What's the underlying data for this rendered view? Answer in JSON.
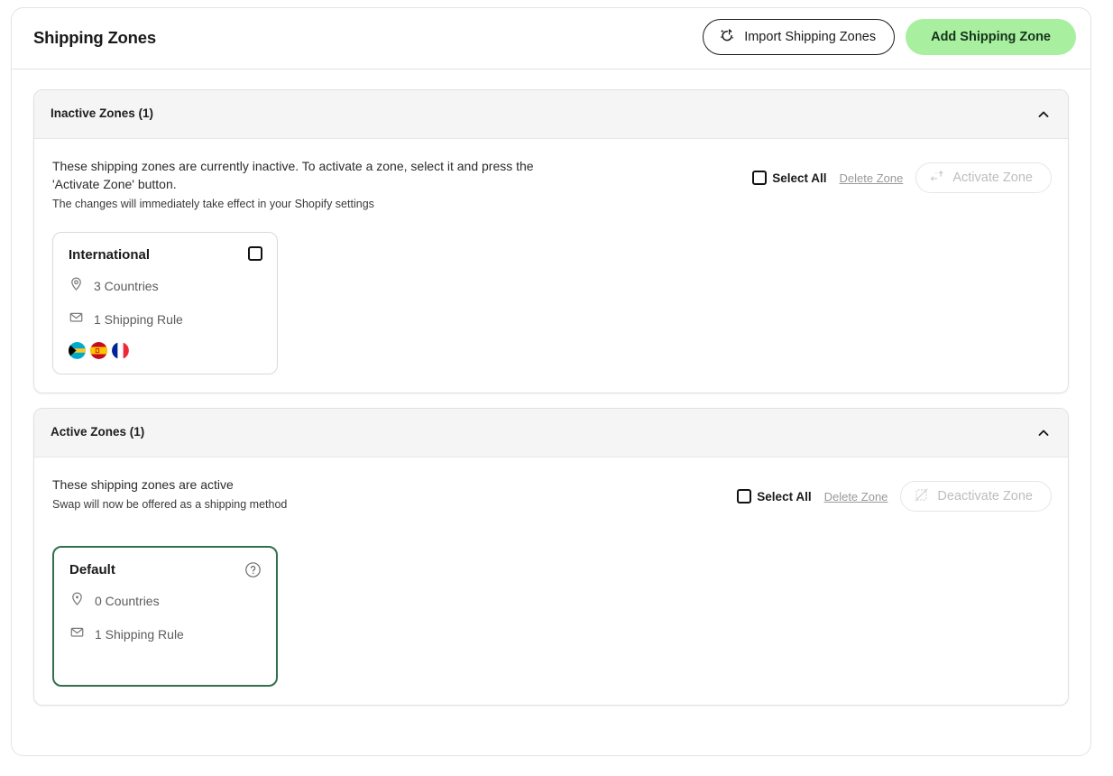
{
  "header": {
    "title": "Shipping Zones",
    "import_button": {
      "label": "Import Shipping Zones",
      "icon": "magic-import-icon"
    },
    "add_button": {
      "label": "Add Shipping Zone",
      "color": "#a9efa0"
    }
  },
  "sections": [
    {
      "id": "inactive",
      "heading": "Inactive Zones (1)",
      "collapse_icon": "chevron-up-icon",
      "description": "These shipping zones are currently inactive. To activate a zone, select it and press the 'Activate Zone' button.",
      "sub_description": "The changes will immediately take effect in your Shopify settings",
      "select_all_label": "Select All",
      "delete_label": "Delete Zone",
      "action_label": "Activate Zone",
      "action_icon": "activate-arrows-icon",
      "action_disabled": true,
      "checked": false,
      "zones": [
        {
          "name": "International",
          "countries": "3 Countries",
          "rules": "1 Shipping Rule",
          "corner": "checkbox",
          "flags": [
            "Bahamas",
            "Spain",
            "France"
          ]
        }
      ]
    },
    {
      "id": "active",
      "heading": "Active Zones (1)",
      "collapse_icon": "chevron-up-icon",
      "description": "These shipping zones are active",
      "sub_description": "Swap will now be offered as a shipping method",
      "select_all_label": "Select All",
      "delete_label": "Delete Zone",
      "action_label": "Deactivate Zone",
      "action_icon": "deactivate-grid-icon",
      "action_disabled": true,
      "checked": false,
      "zones": [
        {
          "name": "Default",
          "countries": "0 Countries",
          "rules": "1 Shipping Rule",
          "corner": "help",
          "border_color": "#31704c",
          "flags": []
        }
      ]
    }
  ]
}
